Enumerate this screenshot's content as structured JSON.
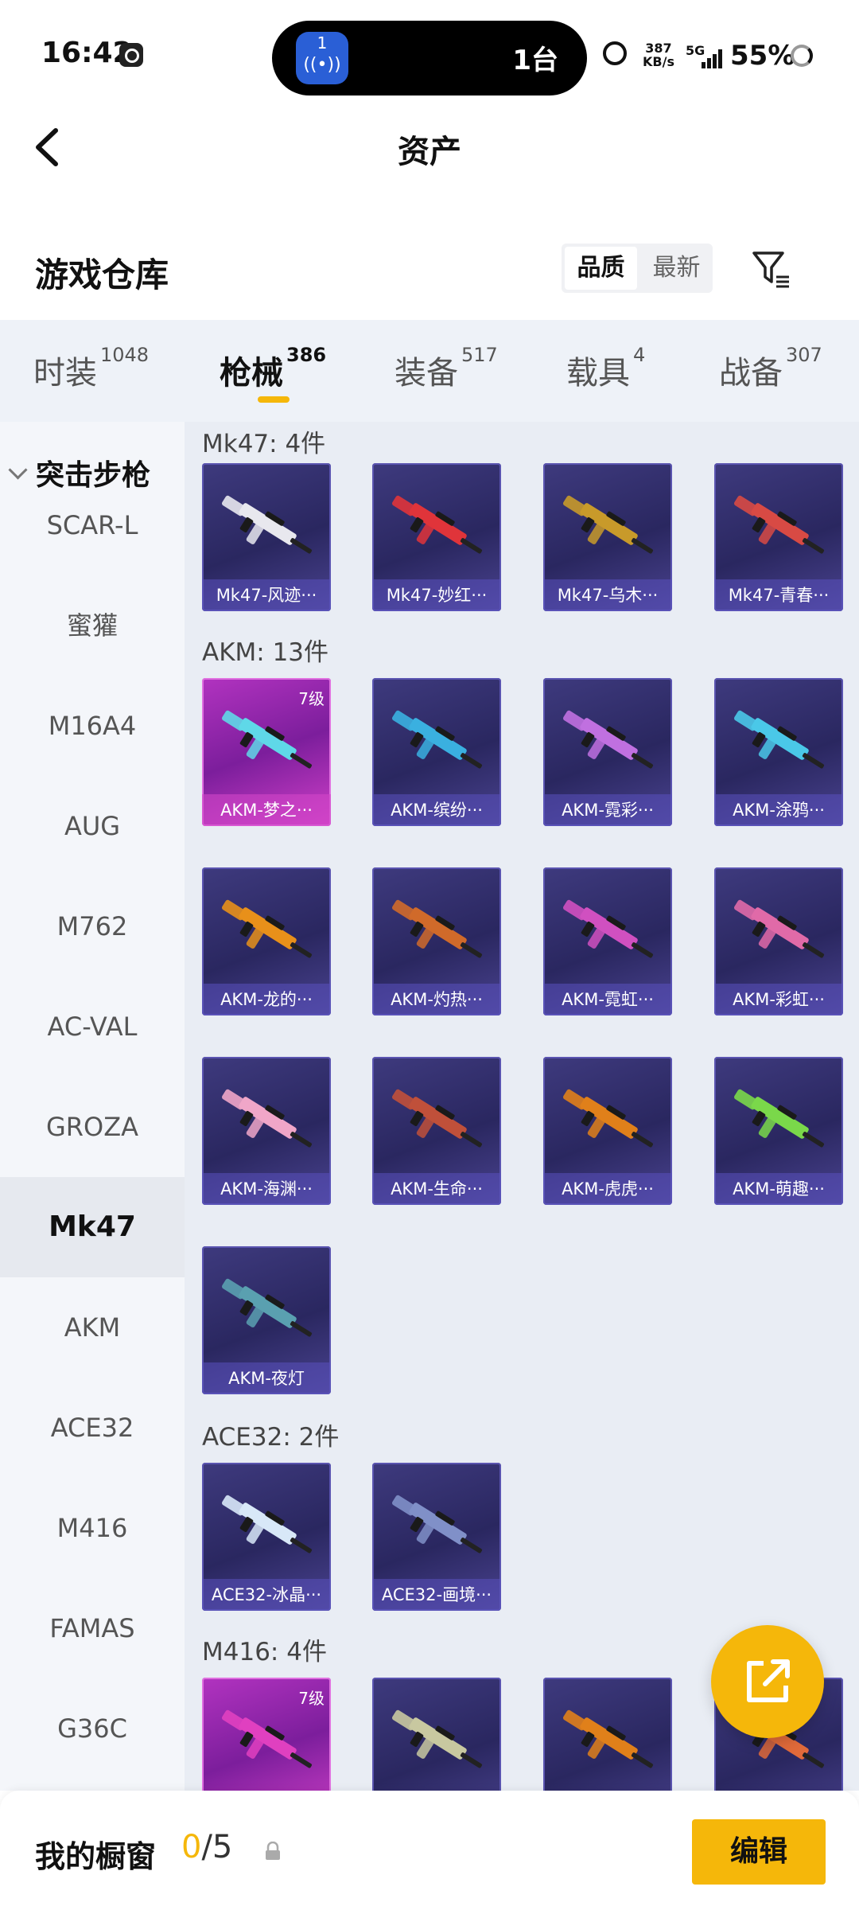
{
  "status_bar": {
    "time": "16:42",
    "island_count": "1台",
    "island_badge": "1",
    "net_speed_value": "387",
    "net_speed_unit": "KB/s",
    "network": "5G",
    "battery": "55%"
  },
  "header": {
    "title": "资产"
  },
  "warehouse": {
    "title": "游戏仓库",
    "sort_options": [
      "品质",
      "最新"
    ],
    "sort_selected": "品质"
  },
  "tabs": [
    {
      "label": "时装",
      "count": "1048"
    },
    {
      "label": "枪械",
      "count": "386",
      "active": true
    },
    {
      "label": "装备",
      "count": "517"
    },
    {
      "label": "载具",
      "count": "4"
    },
    {
      "label": "战备",
      "count": "307"
    }
  ],
  "sidebar": {
    "group": "突击步枪",
    "items": [
      "SCAR-L",
      "蜜獾",
      "M16A4",
      "AUG",
      "M762",
      "AC-VAL",
      "GROZA",
      "Mk47",
      "AKM",
      "ACE32",
      "M416",
      "FAMAS",
      "G36C"
    ],
    "active": "Mk47"
  },
  "sections": [
    {
      "title": "Mk47: 4件",
      "items": [
        {
          "name": "Mk47-风迹···",
          "color": "#e8e8ee"
        },
        {
          "name": "Mk47-妙红···",
          "color": "#e0343a"
        },
        {
          "name": "Mk47-乌木···",
          "color": "#c89a2a"
        },
        {
          "name": "Mk47-青春···",
          "color": "#d84a44"
        }
      ]
    },
    {
      "title": "AKM: 13件",
      "items": [
        {
          "name": "AKM-梦之···",
          "color": "#5fd8e8",
          "level": "7级",
          "legend": true
        },
        {
          "name": "AKM-缤纷···",
          "color": "#3ab0e0"
        },
        {
          "name": "AKM-霓彩···",
          "color": "#c070e0"
        },
        {
          "name": "AKM-涂鸦···",
          "color": "#4ac8e8"
        },
        {
          "name": "AKM-龙的···",
          "color": "#e8901a"
        },
        {
          "name": "AKM-灼热···",
          "color": "#d06a2a"
        },
        {
          "name": "AKM-霓虹···",
          "color": "#d050c0"
        },
        {
          "name": "AKM-彩虹···",
          "color": "#e06aa8"
        },
        {
          "name": "AKM-海渊···",
          "color": "#f0a6c8"
        },
        {
          "name": "AKM-生命···",
          "color": "#c0503a"
        },
        {
          "name": "AKM-虎虎···",
          "color": "#e0801a"
        },
        {
          "name": "AKM-萌趣···",
          "color": "#7ad84a"
        },
        {
          "name": "AKM-夜灯",
          "color": "#5aa0b0"
        }
      ]
    },
    {
      "title": "ACE32: 2件",
      "items": [
        {
          "name": "ACE32-冰晶···",
          "color": "#d8e8f8"
        },
        {
          "name": "ACE32-画境···",
          "color": "#8090c8"
        }
      ]
    },
    {
      "title": "M416: 4件",
      "items": [
        {
          "name": "",
          "color": "#e040c0",
          "level": "7级",
          "legend": true
        },
        {
          "name": "",
          "color": "#c8c8a0"
        },
        {
          "name": "",
          "color": "#e0801a"
        },
        {
          "name": "",
          "color": "#e06a3a"
        }
      ]
    }
  ],
  "bottom_bar": {
    "label": "我的橱窗",
    "count_current": "0",
    "count_total": "/5",
    "edit_label": "编辑"
  },
  "accent_color": "#f5b70a"
}
